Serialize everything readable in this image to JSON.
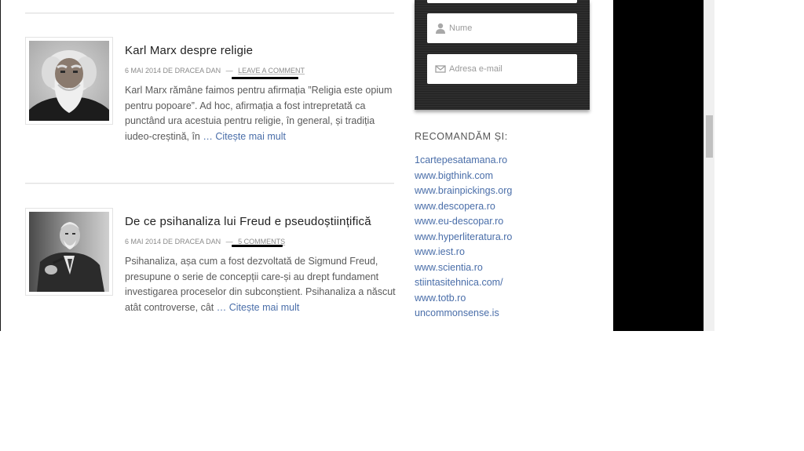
{
  "posts": [
    {
      "title": "Karl Marx despre religie",
      "date": "6 mai 2014",
      "by": "de",
      "author": "Dracea Dan",
      "separator": "—",
      "comments": "Leave a comment",
      "excerpt": "Karl Marx rămâne faimos pentru afirmația ”Religia este opium pentru popoare”. Ad hoc, afirmația a fost intrepretată ca punctând ura acestuia pentru religie, în general, și tradiția iudeo-creștină, în",
      "more": "… Citește mai mult"
    },
    {
      "title": "De ce psihanaliza lui Freud e pseudoștiințifică",
      "date": "6 mai 2014",
      "by": "de",
      "author": "Dracea Dan",
      "separator": "—",
      "comments": "5 comments",
      "excerpt": "Psihanaliza, așa cum a fost dezvoltată de Sigmund Freud, presupune o serie de concepții care-și au drept fundament investigarea proceselor din subconștient. Psihanaliza a născut atât controverse, cât",
      "more": "… Citește mai mult"
    }
  ],
  "signup": {
    "name_placeholder": "Nume",
    "email_placeholder": "Adresa e-mail",
    "name_icon": "user-icon",
    "email_icon": "envelope-icon"
  },
  "recommendations": {
    "title": "Recomandăm și:",
    "links": [
      "1cartepesatamana.ro",
      "www.bigthink.com",
      "www.brainpickings.org",
      "www.descopera.ro",
      "www.eu-descopar.ro",
      "www.hyperliteratura.ro",
      "www.iest.ro",
      "www.scientia.ro",
      "stiintasitehnica.com/",
      "www.totb.ro",
      "uncommonsense.is"
    ]
  },
  "colors": {
    "link": "#4a6ea9",
    "text": "#5a5a5a",
    "title": "#222222",
    "panel": "#000000"
  }
}
